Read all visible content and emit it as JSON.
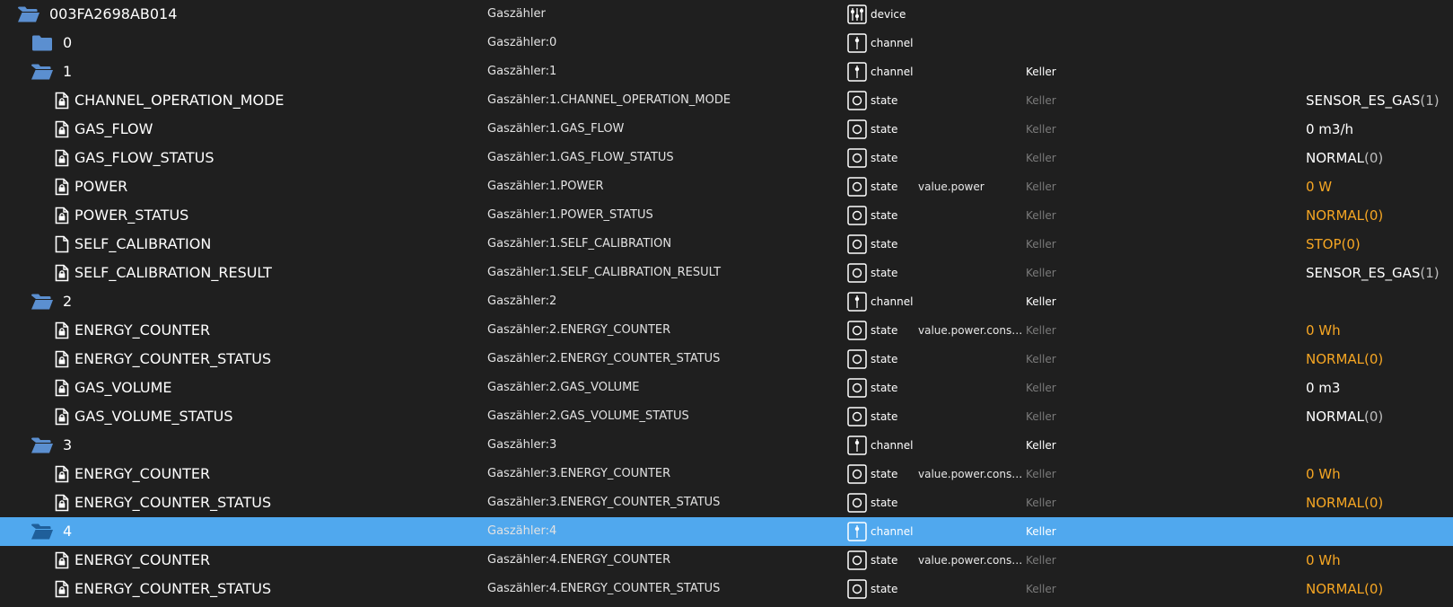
{
  "colors": {
    "folder": "#5b8fd0",
    "selected_row": "#50a8ee",
    "value_orange": "#f6a623",
    "room_dim": "#7a7a7a"
  },
  "rows": [
    {
      "depth": 0,
      "icon": "folder-open-icon",
      "name": "003FA2698AB014",
      "id": "Gaszähler",
      "type_icon": "device-icon",
      "type": "device",
      "role": "",
      "room": "",
      "room_style": "",
      "value": "",
      "value_style": ""
    },
    {
      "depth": 1,
      "icon": "folder-icon",
      "name": "0",
      "id": "Gaszähler:0",
      "type_icon": "channel-icon",
      "type": "channel",
      "role": "",
      "room": "",
      "room_style": "",
      "value": "",
      "value_style": ""
    },
    {
      "depth": 1,
      "icon": "folder-open-icon",
      "name": "1",
      "id": "Gaszähler:1",
      "type_icon": "channel-icon",
      "type": "channel",
      "role": "",
      "room": "Keller",
      "room_style": "bright",
      "value": "",
      "value_style": ""
    },
    {
      "depth": 2,
      "icon": "file-lock-icon",
      "name": "CHANNEL_OPERATION_MODE",
      "id": "Gaszähler:1.CHANNEL_OPERATION_MODE",
      "type_icon": "state-icon",
      "type": "state",
      "role": "",
      "room": "Keller",
      "room_style": "dim",
      "value": "SENSOR_ES_GAS",
      "value_suffix": "(1)",
      "value_style": "white"
    },
    {
      "depth": 2,
      "icon": "file-lock-icon",
      "name": "GAS_FLOW",
      "id": "Gaszähler:1.GAS_FLOW",
      "type_icon": "state-icon",
      "type": "state",
      "role": "",
      "room": "Keller",
      "room_style": "dim",
      "value": "0 m3/h",
      "value_style": "white"
    },
    {
      "depth": 2,
      "icon": "file-lock-icon",
      "name": "GAS_FLOW_STATUS",
      "id": "Gaszähler:1.GAS_FLOW_STATUS",
      "type_icon": "state-icon",
      "type": "state",
      "role": "",
      "room": "Keller",
      "room_style": "dim",
      "value": "NORMAL",
      "value_suffix": "(0)",
      "value_style": "white"
    },
    {
      "depth": 2,
      "icon": "file-lock-icon",
      "name": "POWER",
      "id": "Gaszähler:1.POWER",
      "type_icon": "state-icon",
      "type": "state",
      "role": "value.power",
      "room": "Keller",
      "room_style": "dim",
      "value": "0 W",
      "value_style": "orange"
    },
    {
      "depth": 2,
      "icon": "file-lock-icon",
      "name": "POWER_STATUS",
      "id": "Gaszähler:1.POWER_STATUS",
      "type_icon": "state-icon",
      "type": "state",
      "role": "",
      "room": "Keller",
      "room_style": "dim",
      "value": "NORMAL(0)",
      "value_style": "orange"
    },
    {
      "depth": 2,
      "icon": "file-icon",
      "name": "SELF_CALIBRATION",
      "id": "Gaszähler:1.SELF_CALIBRATION",
      "type_icon": "state-icon",
      "type": "state",
      "role": "",
      "room": "Keller",
      "room_style": "dim",
      "value": "STOP(0)",
      "value_style": "orange"
    },
    {
      "depth": 2,
      "icon": "file-lock-icon",
      "name": "SELF_CALIBRATION_RESULT",
      "id": "Gaszähler:1.SELF_CALIBRATION_RESULT",
      "type_icon": "state-icon",
      "type": "state",
      "role": "",
      "room": "Keller",
      "room_style": "dim",
      "value": "SENSOR_ES_GAS",
      "value_suffix": "(1)",
      "value_style": "white"
    },
    {
      "depth": 1,
      "icon": "folder-open-icon",
      "name": "2",
      "id": "Gaszähler:2",
      "type_icon": "channel-icon",
      "type": "channel",
      "role": "",
      "room": "Keller",
      "room_style": "bright",
      "value": "",
      "value_style": ""
    },
    {
      "depth": 2,
      "icon": "file-lock-icon",
      "name": "ENERGY_COUNTER",
      "id": "Gaszähler:2.ENERGY_COUNTER",
      "type_icon": "state-icon",
      "type": "state",
      "role": "value.power.consum...",
      "room": "Keller",
      "room_style": "dim",
      "value": "0 Wh",
      "value_style": "orange"
    },
    {
      "depth": 2,
      "icon": "file-lock-icon",
      "name": "ENERGY_COUNTER_STATUS",
      "id": "Gaszähler:2.ENERGY_COUNTER_STATUS",
      "type_icon": "state-icon",
      "type": "state",
      "role": "",
      "room": "Keller",
      "room_style": "dim",
      "value": "NORMAL(0)",
      "value_style": "orange"
    },
    {
      "depth": 2,
      "icon": "file-lock-icon",
      "name": "GAS_VOLUME",
      "id": "Gaszähler:2.GAS_VOLUME",
      "type_icon": "state-icon",
      "type": "state",
      "role": "",
      "room": "Keller",
      "room_style": "dim",
      "value": "0 m3",
      "value_style": "white"
    },
    {
      "depth": 2,
      "icon": "file-lock-icon",
      "name": "GAS_VOLUME_STATUS",
      "id": "Gaszähler:2.GAS_VOLUME_STATUS",
      "type_icon": "state-icon",
      "type": "state",
      "role": "",
      "room": "Keller",
      "room_style": "dim",
      "value": "NORMAL",
      "value_suffix": "(0)",
      "value_style": "white"
    },
    {
      "depth": 1,
      "icon": "folder-open-icon",
      "name": "3",
      "id": "Gaszähler:3",
      "type_icon": "channel-icon",
      "type": "channel",
      "role": "",
      "room": "Keller",
      "room_style": "bright",
      "value": "",
      "value_style": ""
    },
    {
      "depth": 2,
      "icon": "file-lock-icon",
      "name": "ENERGY_COUNTER",
      "id": "Gaszähler:3.ENERGY_COUNTER",
      "type_icon": "state-icon",
      "type": "state",
      "role": "value.power.consum...",
      "room": "Keller",
      "room_style": "dim",
      "value": "0 Wh",
      "value_style": "orange"
    },
    {
      "depth": 2,
      "icon": "file-lock-icon",
      "name": "ENERGY_COUNTER_STATUS",
      "id": "Gaszähler:3.ENERGY_COUNTER_STATUS",
      "type_icon": "state-icon",
      "type": "state",
      "role": "",
      "room": "Keller",
      "room_style": "dim",
      "value": "NORMAL(0)",
      "value_style": "orange"
    },
    {
      "depth": 1,
      "icon": "folder-open-icon",
      "name": "4",
      "id": "Gaszähler:4",
      "type_icon": "channel-icon",
      "type": "channel",
      "role": "",
      "room": "Keller",
      "room_style": "bright",
      "value": "",
      "value_style": "",
      "selected": true
    },
    {
      "depth": 2,
      "icon": "file-lock-icon",
      "name": "ENERGY_COUNTER",
      "id": "Gaszähler:4.ENERGY_COUNTER",
      "type_icon": "state-icon",
      "type": "state",
      "role": "value.power.consum...",
      "room": "Keller",
      "room_style": "dim",
      "value": "0 Wh",
      "value_style": "orange"
    },
    {
      "depth": 2,
      "icon": "file-lock-icon",
      "name": "ENERGY_COUNTER_STATUS",
      "id": "Gaszähler:4.ENERGY_COUNTER_STATUS",
      "type_icon": "state-icon",
      "type": "state",
      "role": "",
      "room": "Keller",
      "room_style": "dim",
      "value": "NORMAL(0)",
      "value_style": "orange"
    }
  ]
}
